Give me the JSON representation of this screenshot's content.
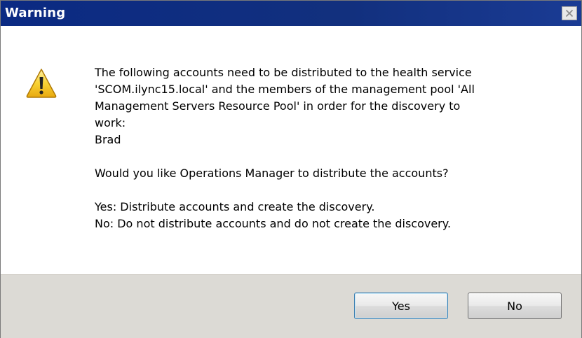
{
  "window": {
    "title": "Warning"
  },
  "message": {
    "paragraph1": "The following accounts need to be distributed to the health service\n'SCOM.ilync15.local' and the members of the management pool 'All\nManagement Servers Resource Pool' in order for the discovery to\nwork:\nBrad",
    "paragraph2": "Would you like Operations Manager to distribute the accounts?",
    "paragraph3": "Yes: Distribute accounts and create the discovery.\nNo: Do not distribute accounts and do not create the discovery."
  },
  "buttons": {
    "yes": "Yes",
    "no": "No"
  },
  "icons": {
    "main": "warning-icon",
    "close": "close-icon"
  },
  "colors": {
    "titlebar": "#1a3b94",
    "footer": "#dcdad5",
    "warning_yellow": "#f6c51b"
  }
}
